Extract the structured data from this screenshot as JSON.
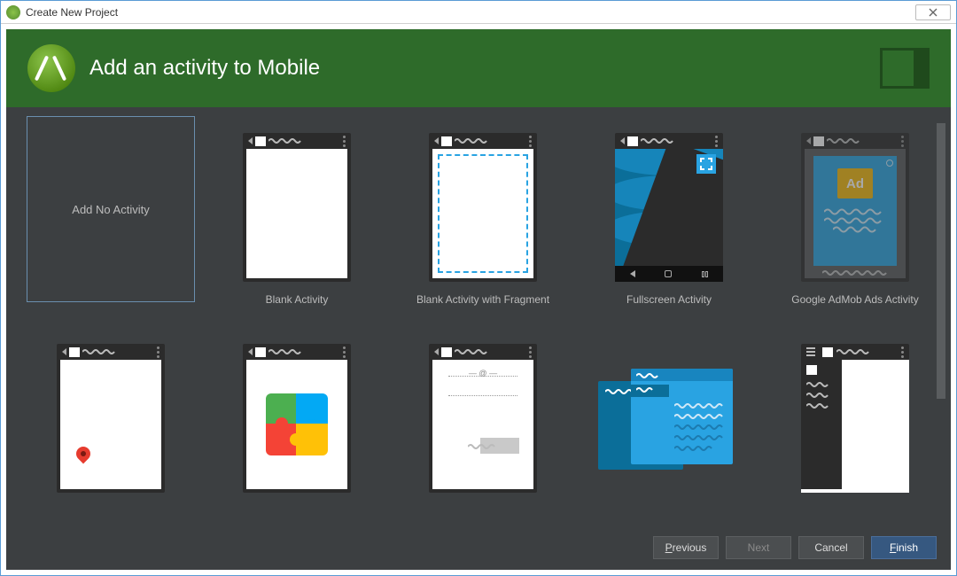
{
  "window": {
    "title": "Create New Project"
  },
  "banner": {
    "title": "Add an activity to Mobile"
  },
  "templates": [
    {
      "label": "Add No Activity"
    },
    {
      "label": "Blank Activity"
    },
    {
      "label": "Blank Activity with Fragment"
    },
    {
      "label": "Fullscreen Activity"
    },
    {
      "label": "Google AdMob Ads Activity"
    },
    {
      "label": ""
    },
    {
      "label": ""
    },
    {
      "label": ""
    },
    {
      "label": ""
    },
    {
      "label": ""
    }
  ],
  "admob": {
    "badge": "Ad"
  },
  "buttons": {
    "previous": "Previous",
    "next": "Next",
    "cancel": "Cancel",
    "finish": "Finish"
  }
}
